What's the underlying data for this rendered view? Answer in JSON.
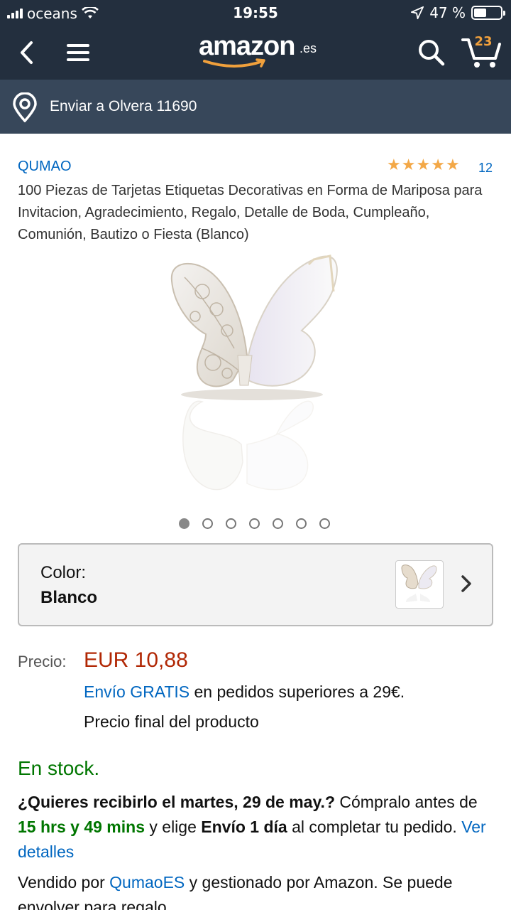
{
  "status_bar": {
    "carrier": "oceans",
    "time": "19:55",
    "battery": "47 %",
    "battery_level": 0.47
  },
  "header": {
    "logo_word": "amazon",
    "logo_tld": ".es",
    "cart_count": "23",
    "icons": {
      "back": "chevron-left-icon",
      "menu": "hamburger-menu-icon",
      "search": "search-icon",
      "cart": "cart-icon"
    }
  },
  "delivery_bar": {
    "text": "Enviar a Olvera 11690",
    "icon": "location-pin-icon"
  },
  "product": {
    "brand": "QUMAO",
    "rating_stars": 5,
    "review_count": "12",
    "title": "100 Piezas de Tarjetas Etiquetas Decorativas en Forma de Mariposa para Invitacion, Agradecimiento, Regalo, Detalle de Boda, Cumpleaño, Comunión, Bautizo o Fiesta (Blanco)",
    "image_count": 7,
    "active_image": 1
  },
  "color_selector": {
    "label": "Color:",
    "value": "Blanco"
  },
  "pricing": {
    "label": "Precio:",
    "price": "EUR 10,88",
    "shipping_link": "Envío GRATIS",
    "shipping_rest": " en pedidos superiores a 29€.",
    "final_note": "Precio final del producto"
  },
  "availability": {
    "stock": "En stock.",
    "delivery_q": "¿Quieres recibirlo el martes, 29 de may.?",
    "delivery_mid1": " Cómpralo antes de ",
    "countdown": "15 hrs y 49 mins",
    "delivery_mid2": " y elige ",
    "shipping_option": "Envío 1 día",
    "delivery_end": " al completar tu pedido. ",
    "details_link": "Ver detalles",
    "sold_pre": "Vendido por ",
    "seller": "QumaoES",
    "sold_post": " y gestionado por Amazon. Se puede envolver para regalo."
  },
  "colors": {
    "header_bg": "#232f3e",
    "delivery_bg": "#37475a",
    "link": "#0066c0",
    "price": "#b12704",
    "stock": "#007600",
    "star": "#f3a847"
  }
}
